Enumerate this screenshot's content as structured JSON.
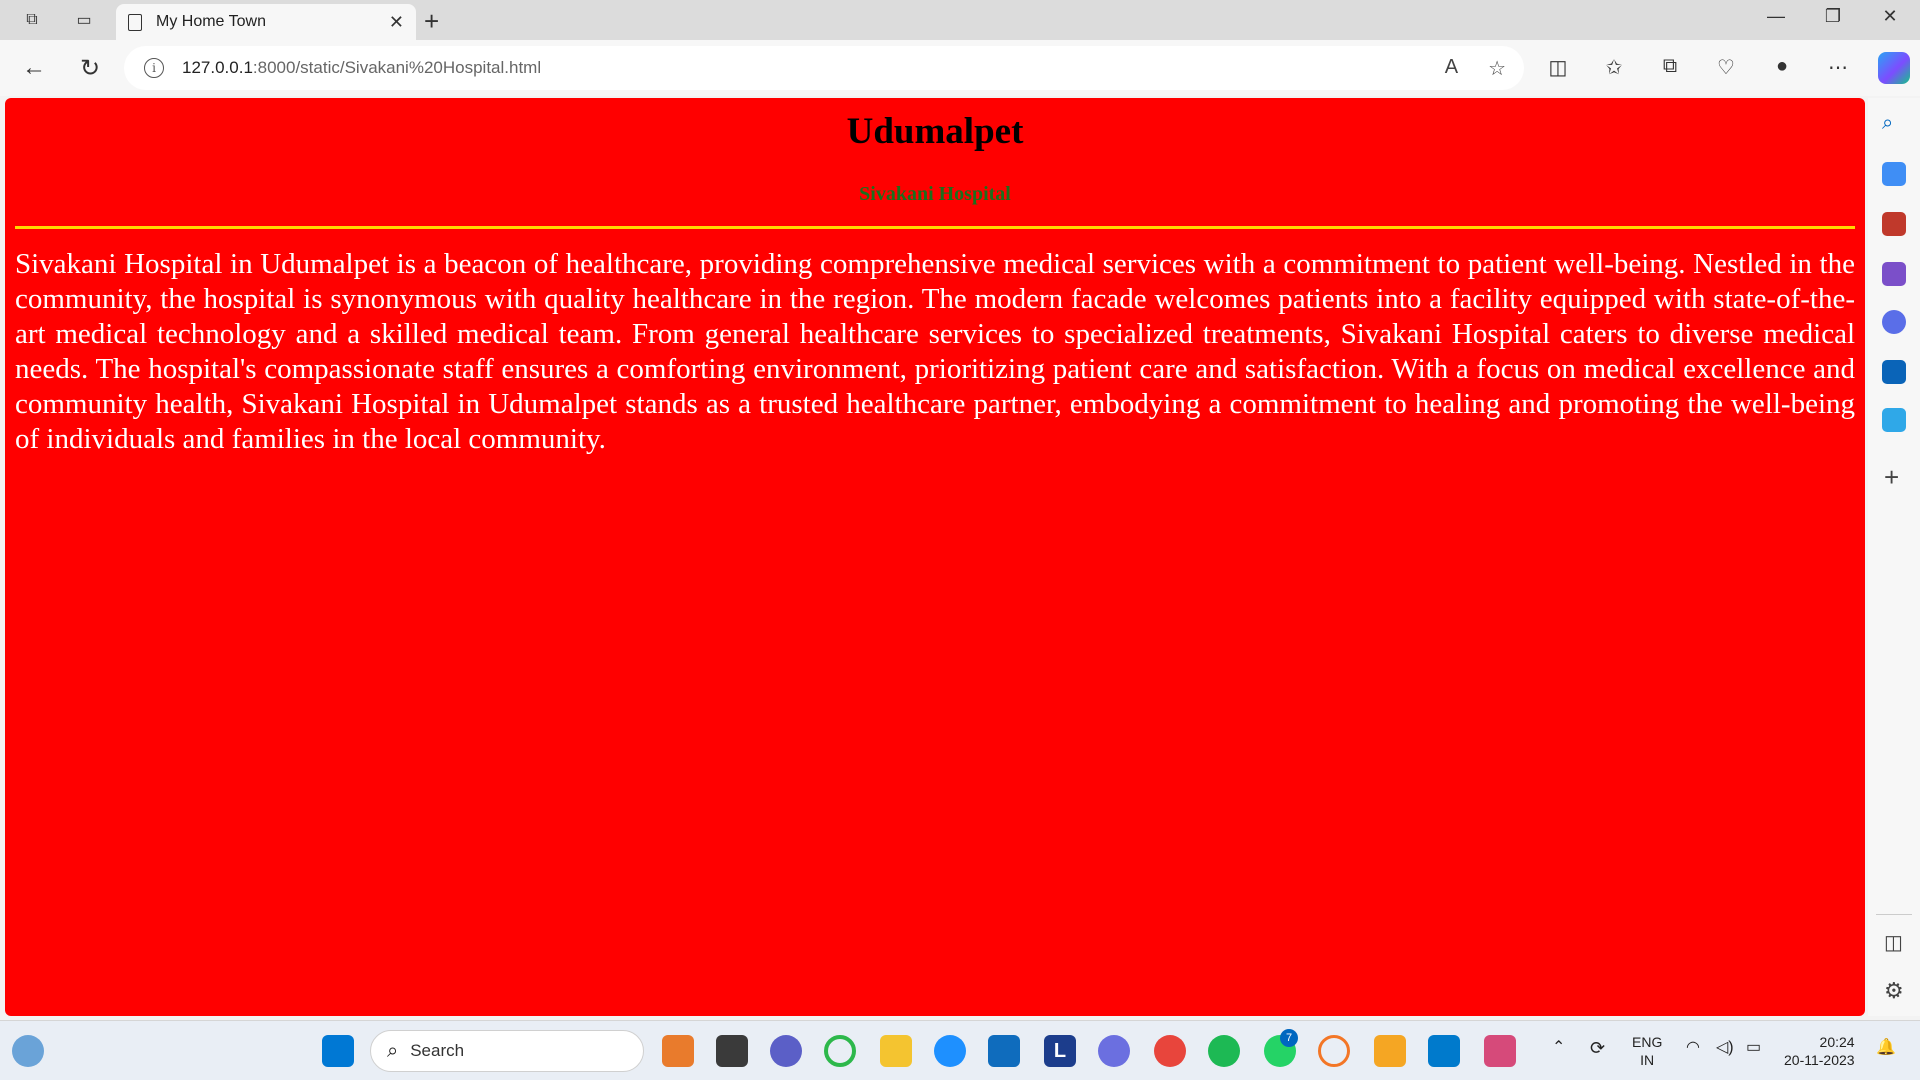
{
  "browser": {
    "tab_title": "My Home Town",
    "url_host": "127.0.0.1",
    "url_path": ":8000/static/Sivakani%20Hospital.html"
  },
  "page": {
    "heading": "Udumalpet",
    "subheading": "Sivakani Hospital",
    "paragraph": "Sivakani Hospital in Udumalpet is a beacon of healthcare, providing comprehensive medical services with a commitment to patient well-being. Nestled in the community, the hospital is synonymous with quality healthcare in the region. The modern facade welcomes patients into a facility equipped with state-of-the-art medical technology and a skilled medical team. From general healthcare services to specialized treatments, Sivakani Hospital caters to diverse medical needs. The hospital's compassionate staff ensures a comforting environment, prioritizing patient care and satisfaction. With a focus on medical excellence and community health, Sivakani Hospital in Udumalpet stands as a trusted healthcare partner, embodying a commitment to healing and promoting the well-being of individuals and families in the local community.",
    "background_color": "#ff0000",
    "heading_color": "#000000",
    "subheading_color": "#1c6f1c",
    "rule_color": "#ffd700",
    "text_color": "#ffffff"
  },
  "taskbar": {
    "search_label": "Search",
    "language_line1": "ENG",
    "language_line2": "IN",
    "time": "20:24",
    "date": "20-11-2023",
    "whatsapp_badge": "7"
  }
}
